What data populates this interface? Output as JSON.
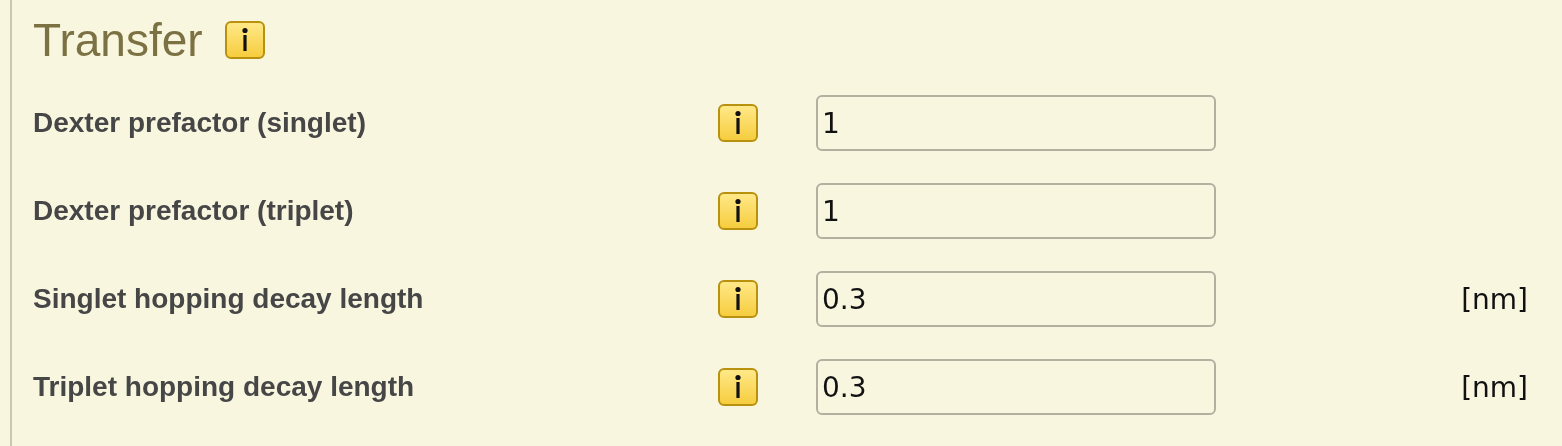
{
  "section": {
    "title": "Transfer"
  },
  "fields": [
    {
      "label": "Dexter prefactor (singlet)",
      "value": "1"
    },
    {
      "label": "Dexter prefactor (triplet)",
      "value": "1"
    },
    {
      "label": "Singlet hopping decay length",
      "value": "0.3",
      "unit": "[nm]"
    },
    {
      "label": "Triplet hopping decay length",
      "value": "0.3",
      "unit": "[nm]"
    }
  ]
}
